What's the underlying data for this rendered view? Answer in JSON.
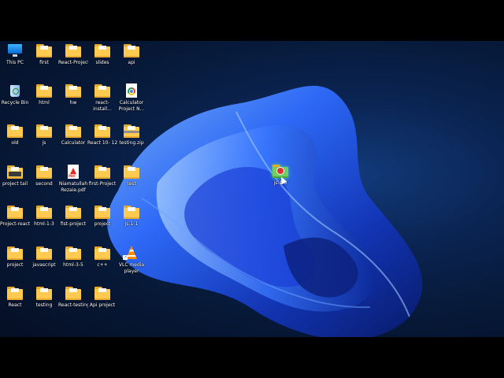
{
  "colors": {
    "folder": "#ffca4f",
    "wallpaper_dark": "#050f24",
    "bloom_blue": "#1e5cff"
  },
  "icons": [
    {
      "label": "This PC",
      "type": "pc"
    },
    {
      "label": "first",
      "type": "folder"
    },
    {
      "label": "React-Project",
      "type": "folder"
    },
    {
      "label": "slides",
      "type": "folder"
    },
    {
      "label": "api",
      "type": "folder"
    },
    {
      "label": "Recycle Bin",
      "type": "bin"
    },
    {
      "label": "html",
      "type": "folder"
    },
    {
      "label": "hw",
      "type": "folder"
    },
    {
      "label": "react-install...",
      "type": "folder"
    },
    {
      "label": "Calculator Project N...",
      "type": "chrome"
    },
    {
      "label": "old",
      "type": "folder"
    },
    {
      "label": "js",
      "type": "folder"
    },
    {
      "label": "Calculator",
      "type": "folder"
    },
    {
      "label": "React 10- 12",
      "type": "folder"
    },
    {
      "label": "testing.zip",
      "type": "zip"
    },
    {
      "label": "project tail",
      "type": "folder"
    },
    {
      "label": "second",
      "type": "folder"
    },
    {
      "label": "Niamatullah Rezaie.pdf",
      "type": "pdf"
    },
    {
      "label": "first-Project",
      "type": "folder"
    },
    {
      "label": "test",
      "type": "folder"
    },
    {
      "label": "Project-react",
      "type": "folder"
    },
    {
      "label": "html-1-3",
      "type": "folder"
    },
    {
      "label": "fist-project",
      "type": "folder"
    },
    {
      "label": "project",
      "type": "folder"
    },
    {
      "label": "js-1-1",
      "type": "folder"
    },
    {
      "label": "project",
      "type": "folder"
    },
    {
      "label": "javascript",
      "type": "folder"
    },
    {
      "label": "html-3-5",
      "type": "folder"
    },
    {
      "label": "c++",
      "type": "folder"
    },
    {
      "label": "VLC media player",
      "type": "vlc"
    },
    {
      "label": "React",
      "type": "folder"
    },
    {
      "label": "testing",
      "type": "folder"
    },
    {
      "label": "React-testing",
      "type": "folder"
    },
    {
      "label": "Api project",
      "type": "folder"
    }
  ],
  "dragged_icon": {
    "label": "js-1-3",
    "type": "folder"
  }
}
